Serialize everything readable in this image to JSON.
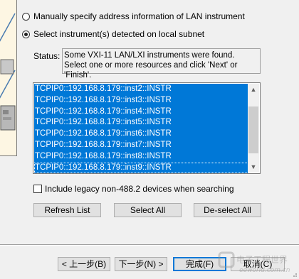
{
  "window": {
    "radio_manual_label": "Manually specify address information of LAN instrument",
    "radio_detected_label": "Select instrument(s) detected on local subnet",
    "status_label": "Status:",
    "status_text": "Some VXI-11 LAN/LXI instruments were found. Select one or more resources and click 'Next' or 'Finish'.",
    "resources": [
      "TCPIP0::192.168.8.179::inst2::INSTR",
      "TCPIP0::192.168.8.179::inst3::INSTR",
      "TCPIP0::192.168.8.179::inst4::INSTR",
      "TCPIP0::192.168.8.179::inst5::INSTR",
      "TCPIP0::192.168.8.179::inst6::INSTR",
      "TCPIP0::192.168.8.179::inst7::INSTR",
      "TCPIP0::192.168.8.179::inst8::INSTR",
      "TCPIP0::192.168.8.179::inst9::INSTR"
    ],
    "legacy_checkbox_label": "Include legacy non-488.2 devices when searching",
    "refresh_label": "Refresh List",
    "select_all_label": "Select All",
    "deselect_all_label": "De-select All",
    "back_label": "< 上一步(B)",
    "next_label": "下一步(N) >",
    "finish_label": "完成(F)",
    "cancel_label": "取消(C)"
  },
  "watermark": {
    "text_cn": "电子工程世界",
    "text_en": "eeworld.com.cn"
  },
  "colors": {
    "selection": "#0078d7",
    "dialog_bg": "#f0f0f0"
  }
}
